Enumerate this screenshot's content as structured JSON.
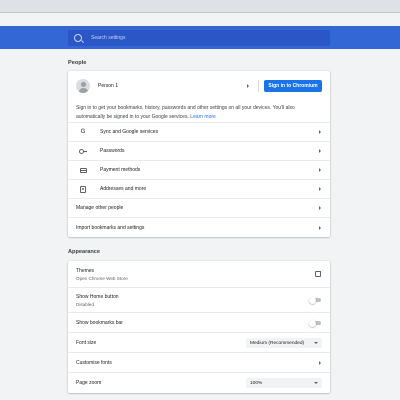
{
  "search": {
    "placeholder": "Search settings"
  },
  "people": {
    "title": "People",
    "profile_name": "Person 1",
    "signin_button": "Sign in to Chromium",
    "description_line1": "Sign in to get your bookmarks, history, passwords and other settings on all your devices. You'll also",
    "description_line2": "automatically be signed in to your Google services.",
    "learn_more": "Learn more",
    "items": [
      {
        "label": "Sync and Google services",
        "icon": "google-icon"
      },
      {
        "label": "Passwords",
        "icon": "key-icon"
      },
      {
        "label": "Payment methods",
        "icon": "credit-card-icon"
      },
      {
        "label": "Addresses and more",
        "icon": "location-pin-icon"
      }
    ],
    "manage_other_people": "Manage other people",
    "import_bookmarks": "Import bookmarks and settings"
  },
  "appearance": {
    "title": "Appearance",
    "themes_label": "Themes",
    "themes_sub": "Open Chrome Web Store",
    "home_button_label": "Show Home button",
    "home_button_sub": "Disabled",
    "bookmarks_bar_label": "Show bookmarks bar",
    "font_size_label": "Font size",
    "font_size_value": "Medium (Recommended)",
    "customise_fonts_label": "Customise fonts",
    "page_zoom_label": "Page zoom",
    "page_zoom_value": "100%"
  },
  "colors": {
    "header": "#3367d6",
    "accent": "#1a73e8",
    "page_bg": "#f1f3f4"
  }
}
